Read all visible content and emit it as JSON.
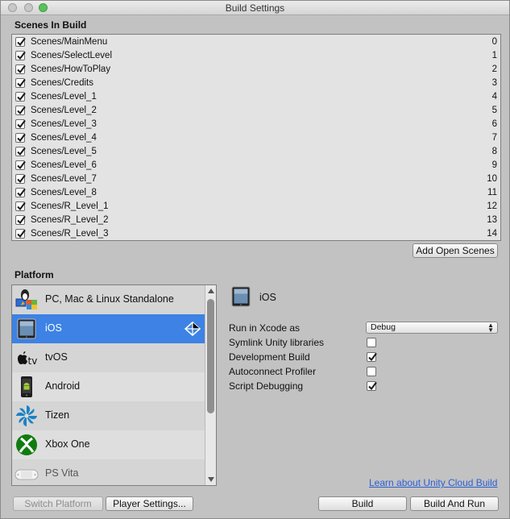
{
  "window": {
    "title": "Build Settings"
  },
  "scenes": {
    "title": "Scenes In Build",
    "items": [
      {
        "name": "Scenes/MainMenu",
        "index": "0",
        "checked": true
      },
      {
        "name": "Scenes/SelectLevel",
        "index": "1",
        "checked": true
      },
      {
        "name": "Scenes/HowToPlay",
        "index": "2",
        "checked": true
      },
      {
        "name": "Scenes/Credits",
        "index": "3",
        "checked": true
      },
      {
        "name": "Scenes/Level_1",
        "index": "4",
        "checked": true
      },
      {
        "name": "Scenes/Level_2",
        "index": "5",
        "checked": true
      },
      {
        "name": "Scenes/Level_3",
        "index": "6",
        "checked": true
      },
      {
        "name": "Scenes/Level_4",
        "index": "7",
        "checked": true
      },
      {
        "name": "Scenes/Level_5",
        "index": "8",
        "checked": true
      },
      {
        "name": "Scenes/Level_6",
        "index": "9",
        "checked": true
      },
      {
        "name": "Scenes/Level_7",
        "index": "10",
        "checked": true
      },
      {
        "name": "Scenes/Level_8",
        "index": "11",
        "checked": true
      },
      {
        "name": "Scenes/R_Level_1",
        "index": "12",
        "checked": true
      },
      {
        "name": "Scenes/R_Level_2",
        "index": "13",
        "checked": true
      },
      {
        "name": "Scenes/R_Level_3",
        "index": "14",
        "checked": true
      }
    ],
    "add_open_scenes_label": "Add Open Scenes"
  },
  "platform": {
    "title": "Platform",
    "items": [
      {
        "label": "PC, Mac & Linux Standalone",
        "icon": "pc-mac-linux-icon",
        "selected": false
      },
      {
        "label": "iOS",
        "icon": "ipad-icon",
        "selected": true
      },
      {
        "label": "tvOS",
        "icon": "apple-tv-icon",
        "selected": false
      },
      {
        "label": "Android",
        "icon": "android-icon",
        "selected": false
      },
      {
        "label": "Tizen",
        "icon": "tizen-icon",
        "selected": false
      },
      {
        "label": "Xbox One",
        "icon": "xbox-icon",
        "selected": false
      },
      {
        "label": "PS Vita",
        "icon": "ps-vita-icon",
        "selected": false
      }
    ]
  },
  "settings": {
    "platform_name": "iOS",
    "run_in_xcode_label": "Run in Xcode as",
    "run_in_xcode_value": "Debug",
    "options": [
      {
        "label": "Symlink Unity libraries",
        "checked": false
      },
      {
        "label": "Development Build",
        "checked": true
      },
      {
        "label": "Autoconnect Profiler",
        "checked": false
      },
      {
        "label": "Script Debugging",
        "checked": true
      }
    ],
    "cloud_build_link": "Learn about Unity Cloud Build"
  },
  "footer": {
    "switch_platform_label": "Switch Platform",
    "player_settings_label": "Player Settings...",
    "build_label": "Build",
    "build_and_run_label": "Build And Run"
  },
  "colors": {
    "selection": "#3d82e4",
    "window_bg": "#c2c2c2",
    "link": "#2c5fd6"
  }
}
